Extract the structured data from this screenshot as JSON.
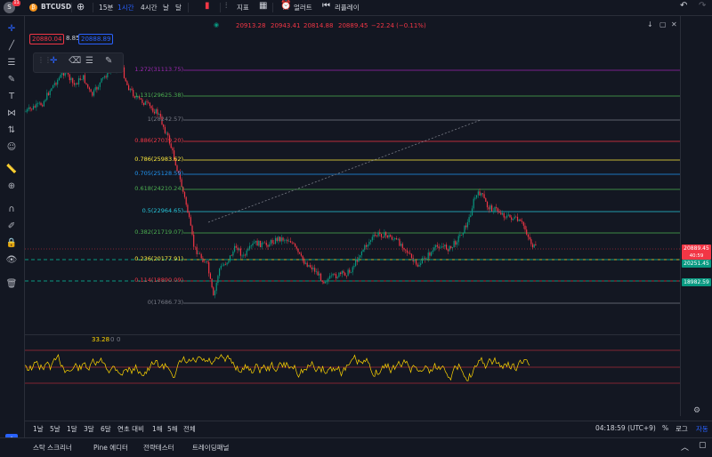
{
  "topbar": {
    "avatar_letter": "S",
    "notif_count": "11",
    "symbol": "BTCUSD",
    "intervals": [
      "15분",
      "1시간",
      "4시간"
    ],
    "active_interval": "1시간",
    "chart_type_label": "날",
    "chart_type2_label": "달",
    "indicators_label": "지표",
    "alert_label": "얼러트",
    "replay_label": "리플레이"
  },
  "ohlc": {
    "open": "20913.28",
    "high": "20943.41",
    "low": "20814.88",
    "close": "20889.45",
    "change": "−22.24 (−0.11%)"
  },
  "order_inputs": {
    "sell": "20880.04",
    "spread": "8.85",
    "buy": "20888.89"
  },
  "fibonacci": [
    {
      "ratio": "1.272",
      "price": "31113.75",
      "color": "#9c27b0"
    },
    {
      "ratio": "1.131",
      "price": "29625.38",
      "color": "#4caf50"
    },
    {
      "ratio": "1",
      "price": "28242.57",
      "color": "#787b86"
    },
    {
      "ratio": "0.886",
      "price": "27039.20",
      "color": "#f23645"
    },
    {
      "ratio": "0.786",
      "price": "25983.62",
      "color": "#ffeb3b"
    },
    {
      "ratio": "0.705",
      "price": "25128.59",
      "color": "#2196f3"
    },
    {
      "ratio": "0.618",
      "price": "24210.24",
      "color": "#4caf50"
    },
    {
      "ratio": "0.5",
      "price": "22964.65",
      "color": "#26c6da"
    },
    {
      "ratio": "0.382",
      "price": "21719.07",
      "color": "#4caf50"
    },
    {
      "ratio": "0.236",
      "price": "20177.91",
      "color": "#ffeb3b"
    },
    {
      "ratio": "0.114",
      "price": "18890.09",
      "color": "#f23645"
    },
    {
      "ratio": "0",
      "price": "17686.73",
      "color": "#787b86"
    }
  ],
  "price_tags": [
    {
      "value": "20889.45",
      "sub": "40:59",
      "color": "#f23645"
    },
    {
      "value": "20251.45",
      "color": "#089981"
    },
    {
      "value": "18982.59",
      "color": "#089981"
    }
  ],
  "oscillator": {
    "value": "33.28",
    "extra1": "0",
    "extra2": "0",
    "line_color": "#ffd600"
  },
  "bottombar": {
    "ranges": [
      "1날",
      "5날",
      "1달",
      "3달",
      "6달",
      "연초 대비",
      "1해",
      "5해",
      "전체"
    ],
    "clock": "04:18:59 (UTC+9)",
    "pct_label": "%",
    "log_label": "로그",
    "auto_label": "자동"
  },
  "footer": {
    "tabs": [
      "스탁 스크리너",
      "Pine 에디터",
      "전략테스터",
      "트레이딩패널"
    ]
  },
  "colors": {
    "background": "#131722",
    "up": "#089981",
    "down": "#f23645",
    "accent": "#2962ff"
  }
}
